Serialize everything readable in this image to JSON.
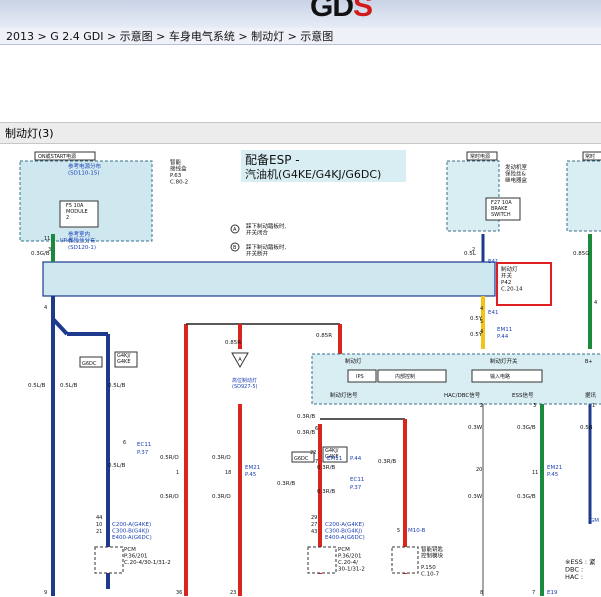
{
  "header": {
    "logo_text_left": "GD",
    "logo_text_right": "S"
  },
  "breadcrumb": "2013 > G 2.4 GDI > 示意图 > 车身电气系统 > 制动灯 > 示意图",
  "panel_title": "制动灯(3)",
  "diagram": {
    "title_line1": "配备ESP -",
    "title_line2": "汽油机(G4KE/G4KJ/G6DC)",
    "power_on_start": "ON或START电源",
    "power_constant": "常时电源",
    "power_constant_right": "常时",
    "smart_junction": [
      "智能",
      "接线盒",
      "P.63",
      "C.80-2"
    ],
    "ref_dist_1": [
      "参考电源分布",
      "(SD110-15)"
    ],
    "fuse_f5": [
      "F5 10A",
      "MODULE",
      "2"
    ],
    "ref_dist_2": [
      "参考室内",
      "保险丝分布",
      "(SD120-1)"
    ],
    "engine_room_box": [
      "发动机室",
      "保险丝&",
      "继电器盒"
    ],
    "fuse_f27": [
      "F27 10A",
      "BRAKE",
      "SWITCH"
    ],
    "note_a": [
      "踩下制动踏板时,",
      "开关闭合"
    ],
    "note_b": [
      "踩下制动踏板时,",
      "开关断开"
    ],
    "brake_switch": [
      "制动灯",
      "开关",
      "P42",
      "C.20-14"
    ],
    "pins": {
      "p11": "11",
      "p3": "3",
      "p2": "2",
      "p4": "4",
      "p4b": "4",
      "p4c": "4",
      "p6": "6",
      "p9": "9",
      "p36": "36",
      "p23": "23",
      "p8": "8",
      "p7": "7",
      "p1": "1",
      "p3b": "3",
      "p5": "5",
      "p18": "18",
      "p20": "20",
      "p11b": "11",
      "p22": "22",
      "p44": "44",
      "p10": "10",
      "p21": "21",
      "p29": "29",
      "p27": "27",
      "p43": "43",
      "p6b": "6",
      "p4d": "4",
      "p5b": "5",
      "p2b": "2",
      "p7b": "7",
      "p1b": "1"
    },
    "conn": {
      "ipb": "I/P-B",
      "e41": "E41",
      "e41b": "E41",
      "em11": "EM11",
      "p44": "P.44",
      "em11b": "EM11",
      "p44b": "P.44",
      "ec11": "EC11",
      "p37": "P.37",
      "em21": "EM21",
      "p45": "P.45",
      "ec11b": "EC11",
      "p37b": "P.37",
      "em21b": "EM21",
      "p45b": "P.45",
      "m10b": "M10-B",
      "e19": "E19",
      "gm": "GM"
    },
    "wires": {
      "w03gb": "0.3G/B",
      "w05l": "0.5L",
      "w085g": "0.85G",
      "w05y": "0.5Y",
      "w05y2": "0.5Y",
      "w085r": "0.85R",
      "w085r2": "0.85R",
      "w05lb": "0.5L/B",
      "w05lb2": "0.5L/B",
      "w05lb3": "0.5L/B",
      "w05lb4": "0.5L/B",
      "w05ro": "0.5R/O",
      "w05ro2": "0.5R/O",
      "w03ro": "0.3R/O",
      "w03ro2": "0.3R/O",
      "w03rb": "0.3R/B",
      "w03rb2": "0.3R/B",
      "w03rb3": "0.3R/B",
      "w03rb4": "0.3R/B",
      "w03rb5": "0.3R/B",
      "w03rb6": "0.3R/B",
      "w03w": "0.3W",
      "w03w2": "0.3W",
      "w03gb2": "0.3G/B",
      "w03gb3": "0.3G/B",
      "w05b": "0.5B"
    },
    "labels": {
      "g6dc": "G6DC",
      "g4kj_g4ke": [
        "G4KJ/",
        "G4KE"
      ],
      "g6dc2": "G6DC",
      "g4kj_g4ke2": [
        "G4KJ/",
        "G4KE"
      ],
      "high_mount": [
        "高位制动灯",
        "(SD927-5)"
      ],
      "esp_ecu_top": "制动灯",
      "esp_brake_switch": "制动灯开关",
      "esp_ips": "IPS",
      "esp_internal": "内部控制",
      "esp_input": "输入电路",
      "esp_bplus": "B+",
      "esp_signal": "制动灯信号",
      "esp_hac": "HAC/DBC信号",
      "esp_ess": "ESS信号",
      "esp_right": "据讯",
      "pcm1": [
        "C200-A(G4KE)",
        "C300-B(G4KJ)",
        "E400-A(G6DC)"
      ],
      "pcm1_box": [
        "PCM",
        "P.36/201",
        "C.20-4/30-1/31-2"
      ],
      "pcm2": [
        "C200-A(G4KE)",
        "C300-B(G4KJ)",
        "E400-A(G6DC)"
      ],
      "pcm2_box": [
        "PCM",
        "P.36/201",
        "C.20-4/",
        "30-1/31-2"
      ],
      "smart_key": [
        "智能钥匙",
        "控制模块"
      ],
      "smart_key_box": [
        "P.150",
        "C.10-7"
      ],
      "legend": [
        "※ESS : 紧",
        "DBC : ",
        "HAC : "
      ]
    },
    "colors": {
      "blue_wire": "#1d3a8c",
      "red_wire": "#d8251d",
      "green_wire": "#1c8a3c",
      "yellow_wire": "#f0c419",
      "box_fill": "#cfe8f0",
      "module_fill": "#d9eef3",
      "highlight": "#e02020",
      "connector_blue": "#1a3fb5"
    }
  }
}
